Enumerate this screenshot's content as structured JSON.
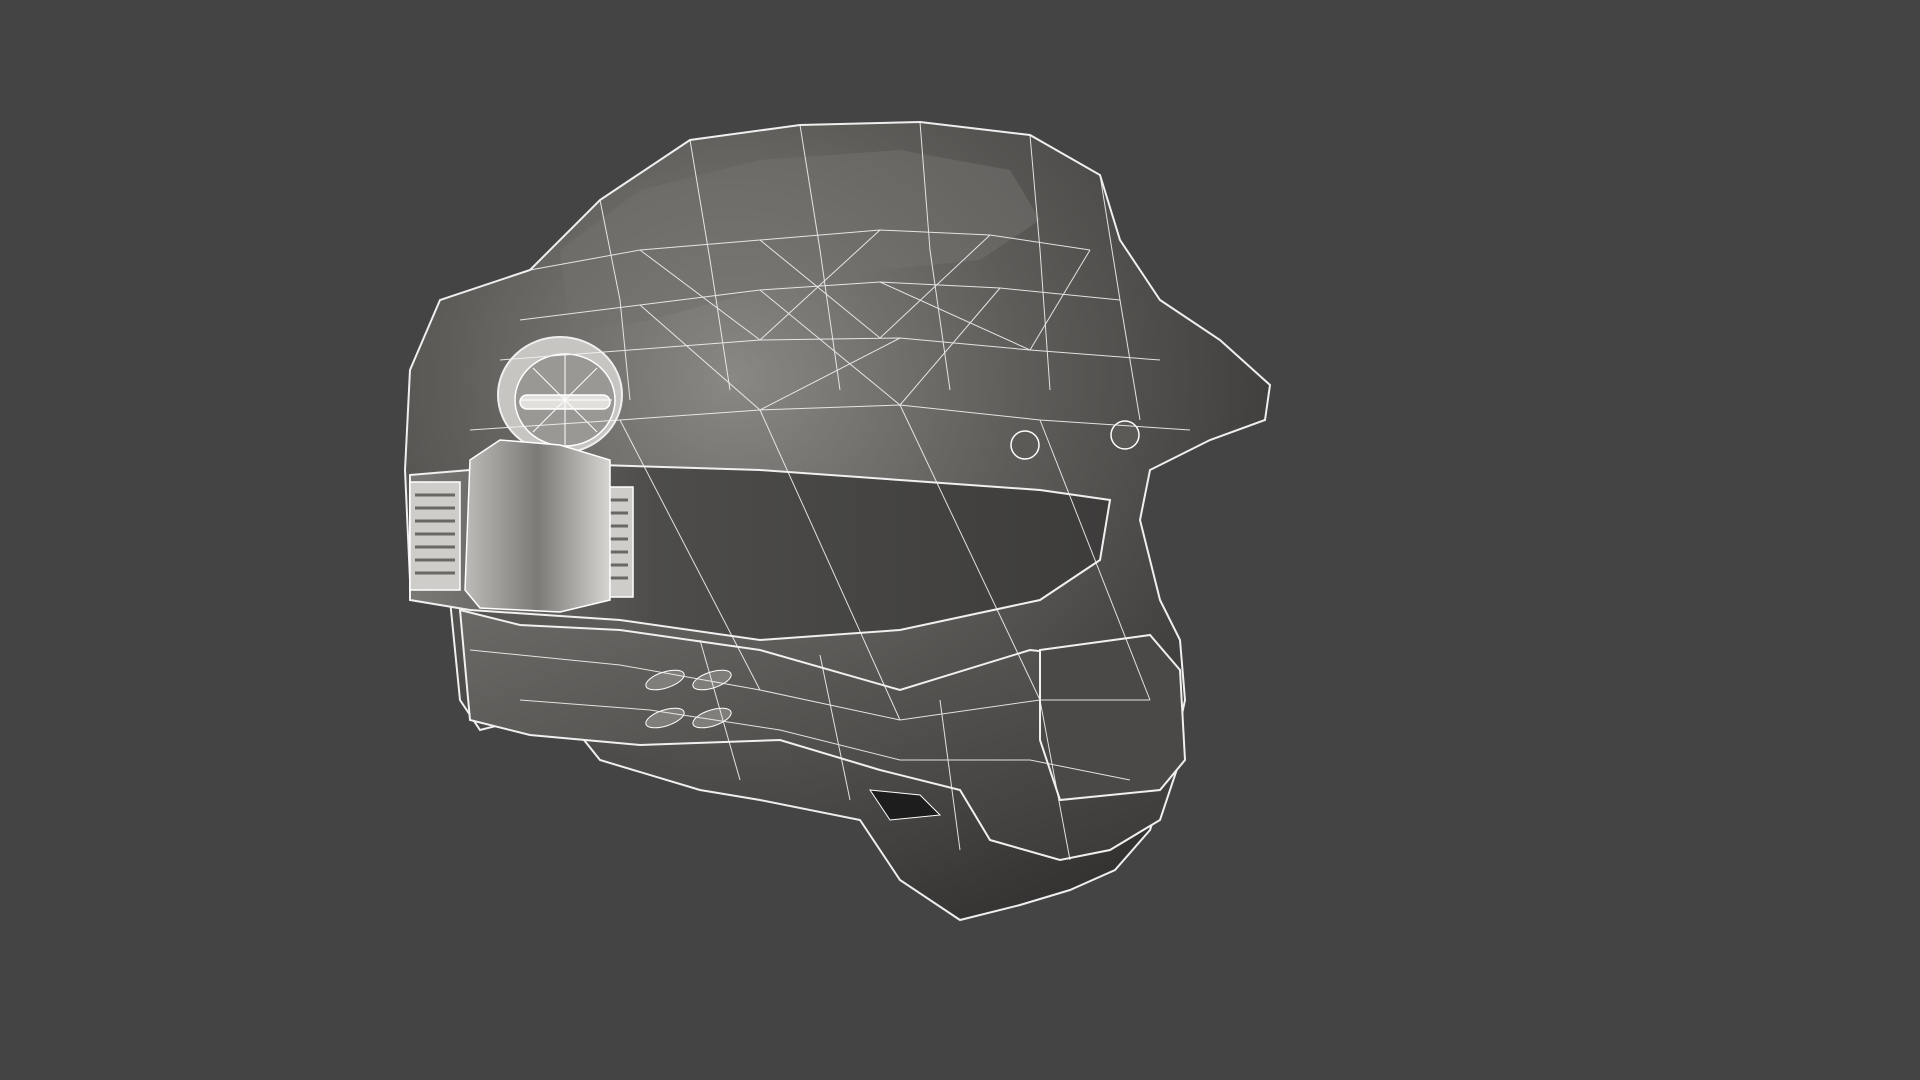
{
  "viewport": {
    "background_color": "#444444",
    "display_mode": "wireframe-over-shaded",
    "subject": "helmet-model"
  },
  "model": {
    "shell_color": "#5a5855",
    "shell_shadow_color": "#3a3937",
    "highlight_color": "#8f8d89",
    "visor_color": "#6b6966",
    "wire_color": "#e8e8e8"
  }
}
